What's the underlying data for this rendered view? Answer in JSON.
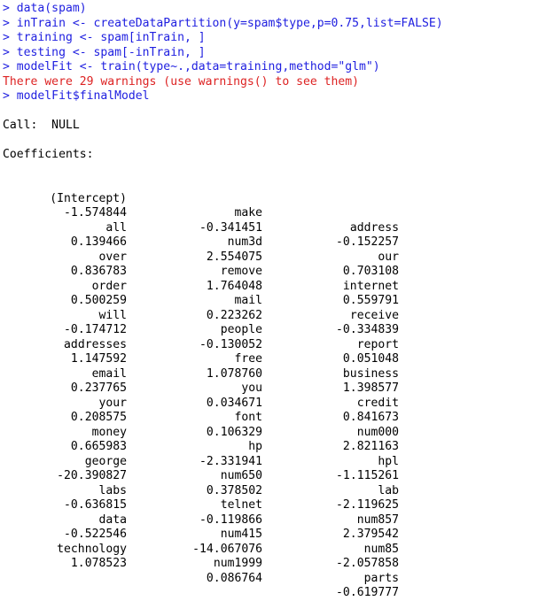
{
  "console": {
    "app": "R console",
    "prompt": ">",
    "colors": {
      "command": "#2020e0",
      "warning": "#dd2222",
      "output": "#000000",
      "background": "#ffffff"
    },
    "commands": [
      "> data(spam)",
      "> inTrain <- createDataPartition(y=spam$type,p=0.75,list=FALSE)",
      "> training <- spam[inTrain, ]",
      "> testing <- spam[-inTrain, ]",
      "> modelFit <- train(type~.,data=training,method=\"glm\")"
    ],
    "warning_line": "There were 29 warnings (use warnings() to see them)",
    "final_command": "> modelFit$finalModel",
    "call_line": "Call:  NULL",
    "coefficients_header": "Coefficients:",
    "coefficients": [
      {
        "names": [
          "(Intercept)",
          "make",
          "address"
        ],
        "values": [
          "-1.574844",
          "-0.341451",
          "-0.152257"
        ]
      },
      {
        "names": [
          "all",
          "num3d",
          "our"
        ],
        "values": [
          "0.139466",
          "2.554075",
          "0.703108"
        ]
      },
      {
        "names": [
          "over",
          "remove",
          "internet"
        ],
        "values": [
          "0.836783",
          "1.764048",
          "0.559791"
        ]
      },
      {
        "names": [
          "order",
          "mail",
          "receive"
        ],
        "values": [
          "0.500259",
          "0.223262",
          "-0.334839"
        ]
      },
      {
        "names": [
          "will",
          "people",
          "report"
        ],
        "values": [
          "-0.174712",
          "-0.130052",
          "0.051048"
        ]
      },
      {
        "names": [
          "addresses",
          "free",
          "business"
        ],
        "values": [
          "1.147592",
          "1.078760",
          "1.398577"
        ]
      },
      {
        "names": [
          "email",
          "you",
          "credit"
        ],
        "values": [
          "0.237765",
          "0.034671",
          "0.841673"
        ]
      },
      {
        "names": [
          "your",
          "font",
          "num000"
        ],
        "values": [
          "0.208575",
          "0.106329",
          "2.821163"
        ]
      },
      {
        "names": [
          "money",
          "hp",
          "hpl"
        ],
        "values": [
          "0.665983",
          "-2.331941",
          "-1.115261"
        ]
      },
      {
        "names": [
          "george",
          "num650",
          "lab"
        ],
        "values": [
          "-20.390827",
          "0.378502",
          "-2.119625"
        ]
      },
      {
        "names": [
          "labs",
          "telnet",
          "num857"
        ],
        "values": [
          "-0.636815",
          "-0.119866",
          "2.379542"
        ]
      },
      {
        "names": [
          "data",
          "num415",
          "num85"
        ],
        "values": [
          "-0.522546",
          "-14.067076",
          "-2.057858"
        ]
      },
      {
        "names": [
          "technology",
          "num1999",
          "parts"
        ],
        "values": [
          "1.078523",
          "0.086764",
          "-0.619777"
        ]
      }
    ]
  }
}
